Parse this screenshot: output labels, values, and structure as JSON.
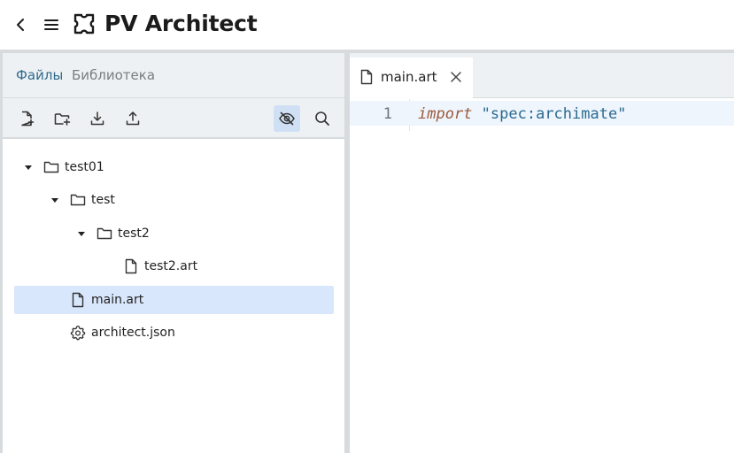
{
  "header": {
    "title": "PV Architect",
    "back_icon": "chevron-left-icon",
    "menu_icon": "hamburger-menu-icon",
    "logo_icon": "puzzle-logo-icon"
  },
  "left_panel": {
    "tabs": [
      {
        "label": "Файлы",
        "active": true
      },
      {
        "label": "Библиотека",
        "active": false
      }
    ],
    "toolbar": [
      {
        "icon": "new-file-icon"
      },
      {
        "icon": "new-folder-icon"
      },
      {
        "icon": "download-icon"
      },
      {
        "icon": "upload-icon"
      },
      {
        "icon": "hide-icon",
        "active": true
      },
      {
        "icon": "search-icon"
      }
    ],
    "tree": [
      {
        "label": "test01",
        "type": "folder",
        "expanded": true,
        "depth": 0
      },
      {
        "label": "test",
        "type": "folder",
        "expanded": true,
        "depth": 1
      },
      {
        "label": "test2",
        "type": "folder",
        "expanded": true,
        "depth": 2
      },
      {
        "label": "test2.art",
        "type": "file",
        "depth": 3
      },
      {
        "label": "main.art",
        "type": "file",
        "depth": 1,
        "selected": true
      },
      {
        "label": "architect.json",
        "type": "settings",
        "depth": 1
      }
    ]
  },
  "editor": {
    "tab": {
      "label": "main.art",
      "icon": "file-icon",
      "close_icon": "close-icon"
    },
    "lines": [
      {
        "number": "1",
        "keyword": "import",
        "string": "\"spec:archimate\""
      }
    ]
  },
  "colors": {
    "accent": "#2f6b8e",
    "panel_bg": "#eef1f3",
    "divider": "#d7dbde",
    "selected_row": "#d9e7fc",
    "active_tool": "#cfe0f5",
    "code_keyword": "#9b5a3c",
    "code_string": "#2b6a8f",
    "current_line": "#eef5fc"
  }
}
